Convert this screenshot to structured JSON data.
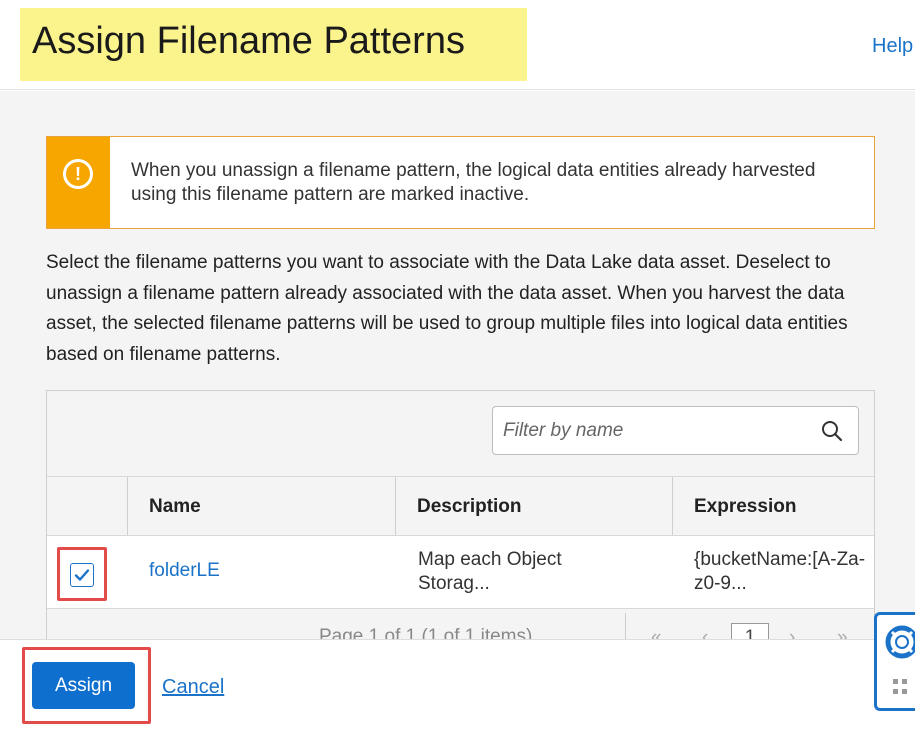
{
  "header": {
    "title": "Assign Filename Patterns",
    "help_label": "Help"
  },
  "warning": {
    "icon": "exclamation-circle-icon",
    "text": "When you unassign a filename pattern, the logical data entities already harvested using this filename pattern are marked inactive."
  },
  "intro_text": "Select the filename patterns you want to associate with the Data Lake data asset. Deselect to unassign a filename pattern already associated with the data asset. When you harvest the data asset, the selected filename patterns will be used to group multiple files into logical data entities based on filename patterns.",
  "filter": {
    "placeholder": "Filter by name",
    "value": ""
  },
  "table": {
    "columns": [
      "",
      "Name",
      "Description",
      "Expression"
    ],
    "rows": [
      {
        "checked": true,
        "name": "folderLE",
        "description": "Map each Object Storag...",
        "expression": "{bucketName:[A-Za-z0-9..."
      }
    ]
  },
  "pagination": {
    "text": "Page 1 of 1 (1 of 1 items)",
    "current_page": "1"
  },
  "footer": {
    "assign_label": "Assign",
    "cancel_label": "Cancel"
  },
  "colors": {
    "accent": "#1a73c9",
    "warning": "#f7a600",
    "highlight": "#fbf38c",
    "annotation": "#e34a4a"
  }
}
